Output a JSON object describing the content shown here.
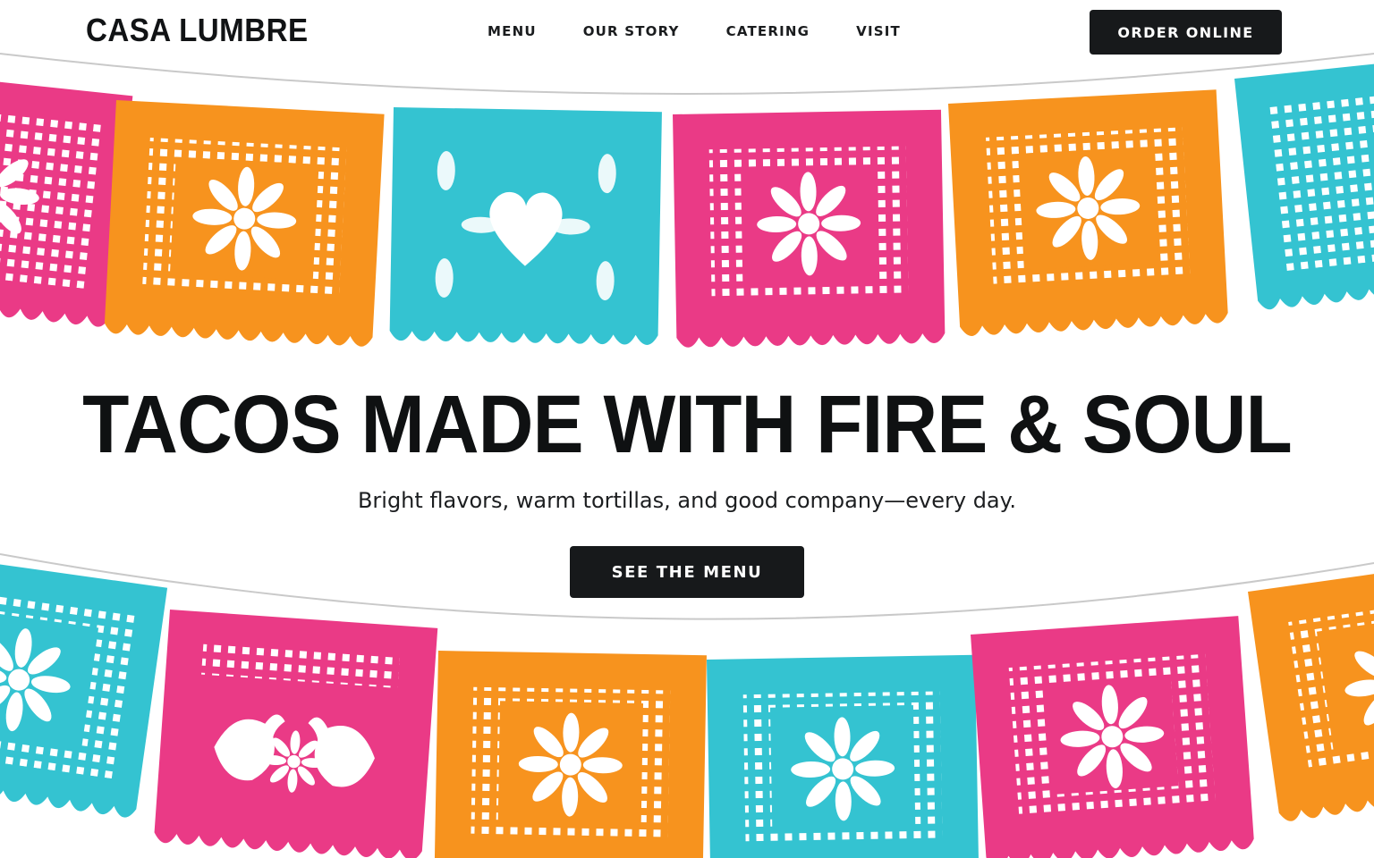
{
  "brand": {
    "name": "CASA LUMBRE"
  },
  "nav": {
    "items": [
      {
        "label": "MENU"
      },
      {
        "label": "OUR STORY"
      },
      {
        "label": "CATERING"
      },
      {
        "label": "VISIT"
      }
    ],
    "order_label": "ORDER ONLINE"
  },
  "hero": {
    "headline": "TACOS MADE WITH FIRE & SOUL",
    "subhead": "Bright flavors, warm tortillas, and good company—every day.",
    "cta_label": "SEE THE MENU"
  },
  "decor": {
    "top_banners": [
      "pink-flower-banner",
      "orange-flower-banner",
      "teal-heart-banner",
      "pink-flower-banner",
      "orange-flower-banner",
      "teal-lattice-banner"
    ],
    "bottom_banners": [
      "teal-flower-banner",
      "pink-birds-banner",
      "orange-flower-banner",
      "teal-flower-banner",
      "pink-flower-banner",
      "orange-flower-banner"
    ]
  },
  "colors": {
    "pink": "#ea3a86",
    "orange": "#f7931e",
    "teal": "#34c3d1",
    "ink": "#17191b",
    "background": "#ffffff"
  }
}
